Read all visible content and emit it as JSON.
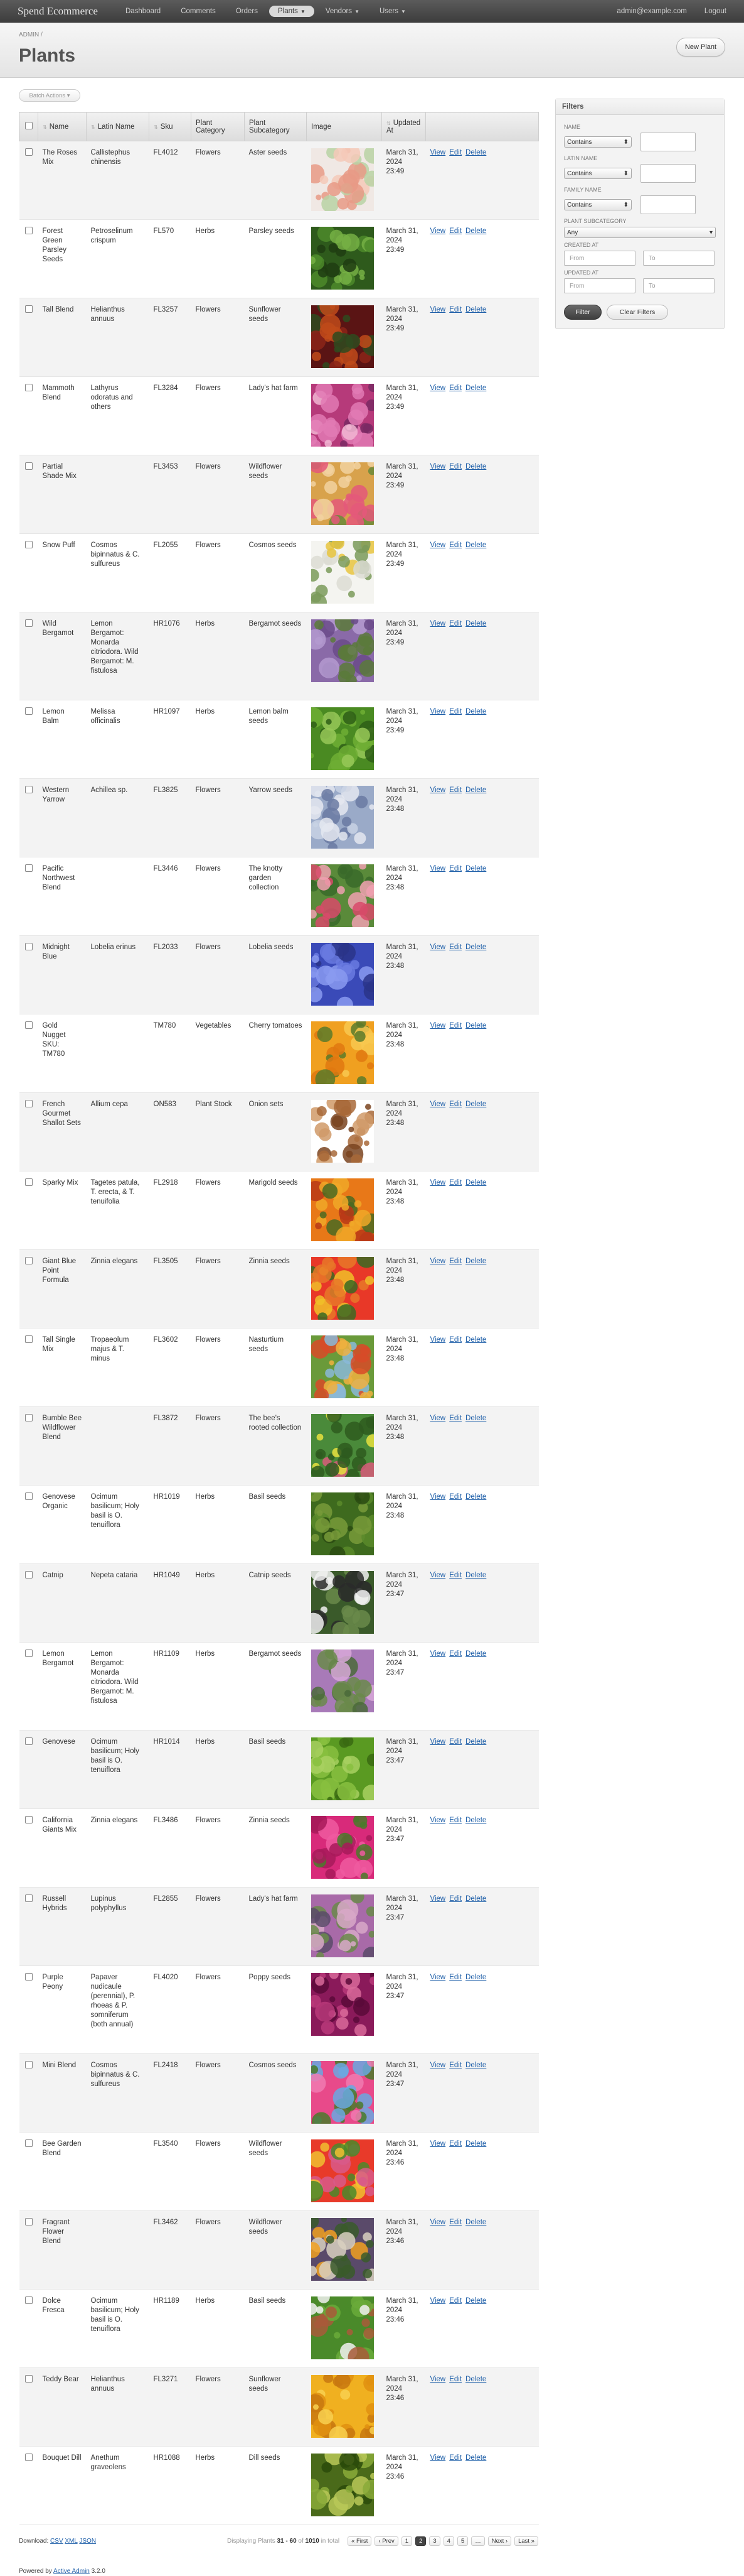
{
  "header": {
    "site_title": "Spend Ecommerce",
    "tabs": [
      {
        "label": "Dashboard",
        "dropdown": false,
        "current": false
      },
      {
        "label": "Comments",
        "dropdown": false,
        "current": false
      },
      {
        "label": "Orders",
        "dropdown": false,
        "current": false
      },
      {
        "label": "Plants",
        "dropdown": true,
        "current": true
      },
      {
        "label": "Vendors",
        "dropdown": true,
        "current": false
      },
      {
        "label": "Users",
        "dropdown": true,
        "current": false
      }
    ],
    "user_email": "admin@example.com",
    "logout_label": "Logout"
  },
  "title_bar": {
    "breadcrumb": "ADMIN /",
    "page_title": "Plants",
    "new_button": "New Plant"
  },
  "batch_actions_label": "Batch Actions ▾",
  "table": {
    "columns": [
      "Name",
      "Latin Name",
      "Sku",
      "Plant Category",
      "Plant Subcategory",
      "Image",
      "Updated At"
    ],
    "sortable": [
      true,
      true,
      true,
      false,
      false,
      false,
      true
    ],
    "action_labels": [
      "View",
      "Edit",
      "Delete"
    ],
    "rows": [
      {
        "name": "The Roses Mix",
        "latin": "Callistephus chinensis",
        "sku": "FL4012",
        "category": "Flowers",
        "subcategory": "Aster seeds",
        "updated": "March 31, 2024 23:49",
        "image_colors": [
          "#f0e8e4",
          "#e89a86",
          "#f4c9b8",
          "#b8d2a4"
        ]
      },
      {
        "name": "Forest Green Parsley Seeds",
        "latin": "Petroselinum crispum",
        "sku": "FL570",
        "category": "Herbs",
        "subcategory": "Parsley seeds",
        "updated": "March 31, 2024 23:49",
        "image_colors": [
          "#2e5a1c",
          "#4c8a2a",
          "#76b044",
          "#1f3d12"
        ]
      },
      {
        "name": "Tall Blend",
        "latin": "Helianthus annuus",
        "sku": "FL3257",
        "category": "Flowers",
        "subcategory": "Sunflower seeds",
        "updated": "March 31, 2024 23:49",
        "image_colors": [
          "#5a1414",
          "#8c2418",
          "#c04a1a",
          "#2f4a1e"
        ]
      },
      {
        "name": "Mammoth Blend",
        "latin": "Lathyrus odoratus and others",
        "sku": "FL3284",
        "category": "Flowers",
        "subcategory": "Lady's hat farm",
        "updated": "March 31, 2024 23:49",
        "image_colors": [
          "#b63a7a",
          "#e27ab4",
          "#7a2a64",
          "#f1b6d2"
        ]
      },
      {
        "name": "Partial Shade Mix",
        "latin": "",
        "sku": "FL3453",
        "category": "Flowers",
        "subcategory": "Wildflower seeds",
        "updated": "March 31, 2024 23:49",
        "image_colors": [
          "#d8a24c",
          "#e4587a",
          "#6a8a3a",
          "#f2d2a0"
        ]
      },
      {
        "name": "Snow Puff",
        "latin": "Cosmos bipinnatus & C. sulfureus",
        "sku": "FL2055",
        "category": "Flowers",
        "subcategory": "Cosmos seeds",
        "updated": "March 31, 2024 23:49",
        "image_colors": [
          "#f4f4f0",
          "#dcdcd4",
          "#e8c440",
          "#7a9a5a"
        ]
      },
      {
        "name": "Wild Bergamot",
        "latin": "Lemon Bergamot: Monarda citriodora. Wild Bergamot: M. fistulosa",
        "sku": "HR1076",
        "category": "Herbs",
        "subcategory": "Bergamot seeds",
        "updated": "March 31, 2024 23:49",
        "image_colors": [
          "#8a6aa8",
          "#b49ad0",
          "#5a7a3a",
          "#6a4a8a"
        ]
      },
      {
        "name": "Lemon Balm",
        "latin": "Melissa officinalis",
        "sku": "HR1097",
        "category": "Herbs",
        "subcategory": "Lemon balm seeds",
        "updated": "March 31, 2024 23:49",
        "image_colors": [
          "#4a8a22",
          "#6eae34",
          "#2e5e16",
          "#98c858"
        ]
      },
      {
        "name": "Western Yarrow",
        "latin": "Achillea sp.",
        "sku": "FL3825",
        "category": "Flowers",
        "subcategory": "Yarrow seeds",
        "updated": "March 31, 2024 23:48",
        "image_colors": [
          "#9aaac8",
          "#c8d2e4",
          "#6a7aa2",
          "#e4e8f0"
        ]
      },
      {
        "name": "Pacific Northwest Blend",
        "latin": "",
        "sku": "FL3446",
        "category": "Flowers",
        "subcategory": "The knotty garden collection",
        "updated": "March 31, 2024 23:48",
        "image_colors": [
          "#5a8a3a",
          "#d84a6a",
          "#f0a0b0",
          "#3a6a2a"
        ]
      },
      {
        "name": "Midnight Blue",
        "latin": "Lobelia erinus",
        "sku": "FL2033",
        "category": "Flowers",
        "subcategory": "Lobelia seeds",
        "updated": "March 31, 2024 23:48",
        "image_colors": [
          "#3a4ab8",
          "#6a7ae0",
          "#2a3488",
          "#8a9af0"
        ]
      },
      {
        "name": "Gold Nugget SKU: TM780",
        "latin": "",
        "sku": "TM780",
        "category": "Vegetables",
        "subcategory": "Cherry tomatoes",
        "updated": "March 31, 2024 23:48",
        "image_colors": [
          "#f0a020",
          "#e07810",
          "#5a7a2a",
          "#f8c850"
        ]
      },
      {
        "name": "French Gourmet Shallot Sets",
        "latin": "Allium cepa",
        "sku": "ON583",
        "category": "Plant Stock",
        "subcategory": "Onion sets",
        "updated": "March 31, 2024 23:48",
        "image_colors": [
          "#ffffff",
          "#a86838",
          "#d09a68",
          "#7a4420"
        ]
      },
      {
        "name": "Sparky Mix",
        "latin": "Tagetes patula, T. erecta, & T. tenuifolia",
        "sku": "FL2918",
        "category": "Flowers",
        "subcategory": "Marigold seeds",
        "updated": "March 31, 2024 23:48",
        "image_colors": [
          "#e87818",
          "#f0a828",
          "#b83818",
          "#4a6a22"
        ]
      },
      {
        "name": "Giant Blue Point Formula",
        "latin": "Zinnia elegans",
        "sku": "FL3505",
        "category": "Flowers",
        "subcategory": "Zinnia seeds",
        "updated": "March 31, 2024 23:48",
        "image_colors": [
          "#e83828",
          "#f0c028",
          "#e87828",
          "#3a6a22"
        ]
      },
      {
        "name": "Tall Single Mix",
        "latin": "Tropaeolum majus & T. minus",
        "sku": "FL3602",
        "category": "Flowers",
        "subcategory": "Nasturtium seeds",
        "updated": "March 31, 2024 23:48",
        "image_colors": [
          "#6a9a3a",
          "#d84a28",
          "#8ab8d8",
          "#f0b040"
        ]
      },
      {
        "name": "Bumble Bee Wildflower Blend",
        "latin": "",
        "sku": "FL3872",
        "category": "Flowers",
        "subcategory": "The bee's rooted collection",
        "updated": "March 31, 2024 23:48",
        "image_colors": [
          "#4a8a3a",
          "#e8e040",
          "#d85a7a",
          "#2e5a1e"
        ]
      },
      {
        "name": "Genovese Organic",
        "latin": "Ocimum basilicum; Holy basil is O. tenuiflora",
        "sku": "HR1019",
        "category": "Herbs",
        "subcategory": "Basil seeds",
        "updated": "March 31, 2024 23:48",
        "image_colors": [
          "#3e6a1e",
          "#5a8a2a",
          "#789a3a",
          "#2a4a12"
        ]
      },
      {
        "name": "Catnip",
        "latin": "Nepeta cataria",
        "sku": "HR1049",
        "category": "Herbs",
        "subcategory": "Catnip seeds",
        "updated": "March 31, 2024 23:47",
        "image_colors": [
          "#3a5a2a",
          "#f0f0f0",
          "#2a2a2a",
          "#6a8a4a"
        ]
      },
      {
        "name": "Lemon Bergamot",
        "latin": "Lemon Bergamot: Monarda citriodora. Wild Bergamot: M. fistulosa",
        "sku": "HR1109",
        "category": "Herbs",
        "subcategory": "Bergamot seeds",
        "updated": "March 31, 2024 23:47",
        "image_colors": [
          "#a87ab8",
          "#6a8a4a",
          "#d8a8d8",
          "#4a6a3a"
        ]
      },
      {
        "name": "Genovese",
        "latin": "Ocimum basilicum; Holy basil is O. tenuiflora",
        "sku": "HR1014",
        "category": "Herbs",
        "subcategory": "Basil seeds",
        "updated": "March 31, 2024 23:47",
        "image_colors": [
          "#5a9a22",
          "#88c040",
          "#3a6a12",
          "#a8d060"
        ]
      },
      {
        "name": "California Giants Mix",
        "latin": "Zinnia elegans",
        "sku": "FL3486",
        "category": "Flowers",
        "subcategory": "Zinnia seeds",
        "updated": "March 31, 2024 23:47",
        "image_colors": [
          "#d82a7a",
          "#f05aa0",
          "#4a7a2a",
          "#a81a5a"
        ]
      },
      {
        "name": "Russell Hybrids",
        "latin": "Lupinus polyphyllus",
        "sku": "FL2855",
        "category": "Flowers",
        "subcategory": "Lady's hat farm",
        "updated": "March 31, 2024 23:47",
        "image_colors": [
          "#a86aa8",
          "#6a8a4a",
          "#d8a8c8",
          "#5a4a6a"
        ]
      },
      {
        "name": "Purple Peony",
        "latin": "Papaver nudicaule (perennial), P. rhoeas & P. somniferum (both annual)",
        "sku": "FL4020",
        "category": "Flowers",
        "subcategory": "Poppy seeds",
        "updated": "March 31, 2024 23:47",
        "image_colors": [
          "#8a1a5a",
          "#b83a7a",
          "#5a0a3a",
          "#d86a9a"
        ]
      },
      {
        "name": "Mini Blend",
        "latin": "Cosmos bipinnatus & C. sulfureus",
        "sku": "FL2418",
        "category": "Flowers",
        "subcategory": "Cosmos seeds",
        "updated": "March 31, 2024 23:47",
        "image_colors": [
          "#e84a8a",
          "#6aa8e0",
          "#f07ab0",
          "#4a7a2a"
        ]
      },
      {
        "name": "Bee Garden Blend",
        "latin": "",
        "sku": "FL3540",
        "category": "Flowers",
        "subcategory": "Wildflower seeds",
        "updated": "March 31, 2024 23:46",
        "image_colors": [
          "#e83a2a",
          "#f0c030",
          "#4a8a2a",
          "#d85a8a"
        ]
      },
      {
        "name": "Fragrant Flower Blend",
        "latin": "",
        "sku": "FL3462",
        "category": "Flowers",
        "subcategory": "Wildflower seeds",
        "updated": "March 31, 2024 23:46",
        "image_colors": [
          "#5a4a6a",
          "#f0a020",
          "#d8d0c0",
          "#3a5a2a"
        ]
      },
      {
        "name": "Dolce Fresca",
        "latin": "Ocimum basilicum; Holy basil is O. tenuiflora",
        "sku": "HR1189",
        "category": "Herbs",
        "subcategory": "Basil seeds",
        "updated": "March 31, 2024 23:46",
        "image_colors": [
          "#4a8a2a",
          "#a85a3a",
          "#6aaa3a",
          "#f0f0f0"
        ]
      },
      {
        "name": "Teddy Bear",
        "latin": "Helianthus annuus",
        "sku": "FL3271",
        "category": "Flowers",
        "subcategory": "Sunflower seeds",
        "updated": "March 31, 2024 23:46",
        "image_colors": [
          "#f0b020",
          "#e09010",
          "#f8d050",
          "#c87810"
        ]
      },
      {
        "name": "Bouquet Dill",
        "latin": "Anethum graveolens",
        "sku": "HR1088",
        "category": "Herbs",
        "subcategory": "Dill seeds",
        "updated": "March 31, 2024 23:46",
        "image_colors": [
          "#4a6a1a",
          "#8aaa3a",
          "#2a4a0a",
          "#b8c858"
        ]
      }
    ]
  },
  "pagination": {
    "info_prefix": "Displaying Plants",
    "range": "31 - 60",
    "info_mid": "of",
    "total": "1010",
    "info_suffix": "in total",
    "buttons": [
      "« First",
      "‹ Prev",
      "1",
      "2",
      "3",
      "4",
      "5",
      "…",
      "Next ›",
      "Last »"
    ],
    "current_page": "2"
  },
  "downloads": {
    "label": "Download:",
    "formats": [
      "CSV",
      "XML",
      "JSON"
    ]
  },
  "powered_by": {
    "prefix": "Powered by",
    "link": "Active Admin",
    "version": "3.2.0"
  },
  "sidebar": {
    "title": "Filters",
    "filters": [
      {
        "label": "Name",
        "type": "text",
        "operator": "Contains"
      },
      {
        "label": "Latin Name",
        "type": "text",
        "operator": "Contains"
      },
      {
        "label": "Family Name",
        "type": "text",
        "operator": "Contains"
      },
      {
        "label": "Plant Subcategory",
        "type": "select",
        "value": "Any"
      },
      {
        "label": "Created At",
        "type": "date",
        "from_placeholder": "From",
        "to_placeholder": "To"
      },
      {
        "label": "Updated At",
        "type": "date",
        "from_placeholder": "From",
        "to_placeholder": "To"
      }
    ],
    "submit_label": "Filter",
    "clear_label": "Clear Filters"
  },
  "colors": {
    "header_bg": "#4a4a4a",
    "link": "#1d5ea8",
    "row_alt": "#f3f3f3"
  }
}
